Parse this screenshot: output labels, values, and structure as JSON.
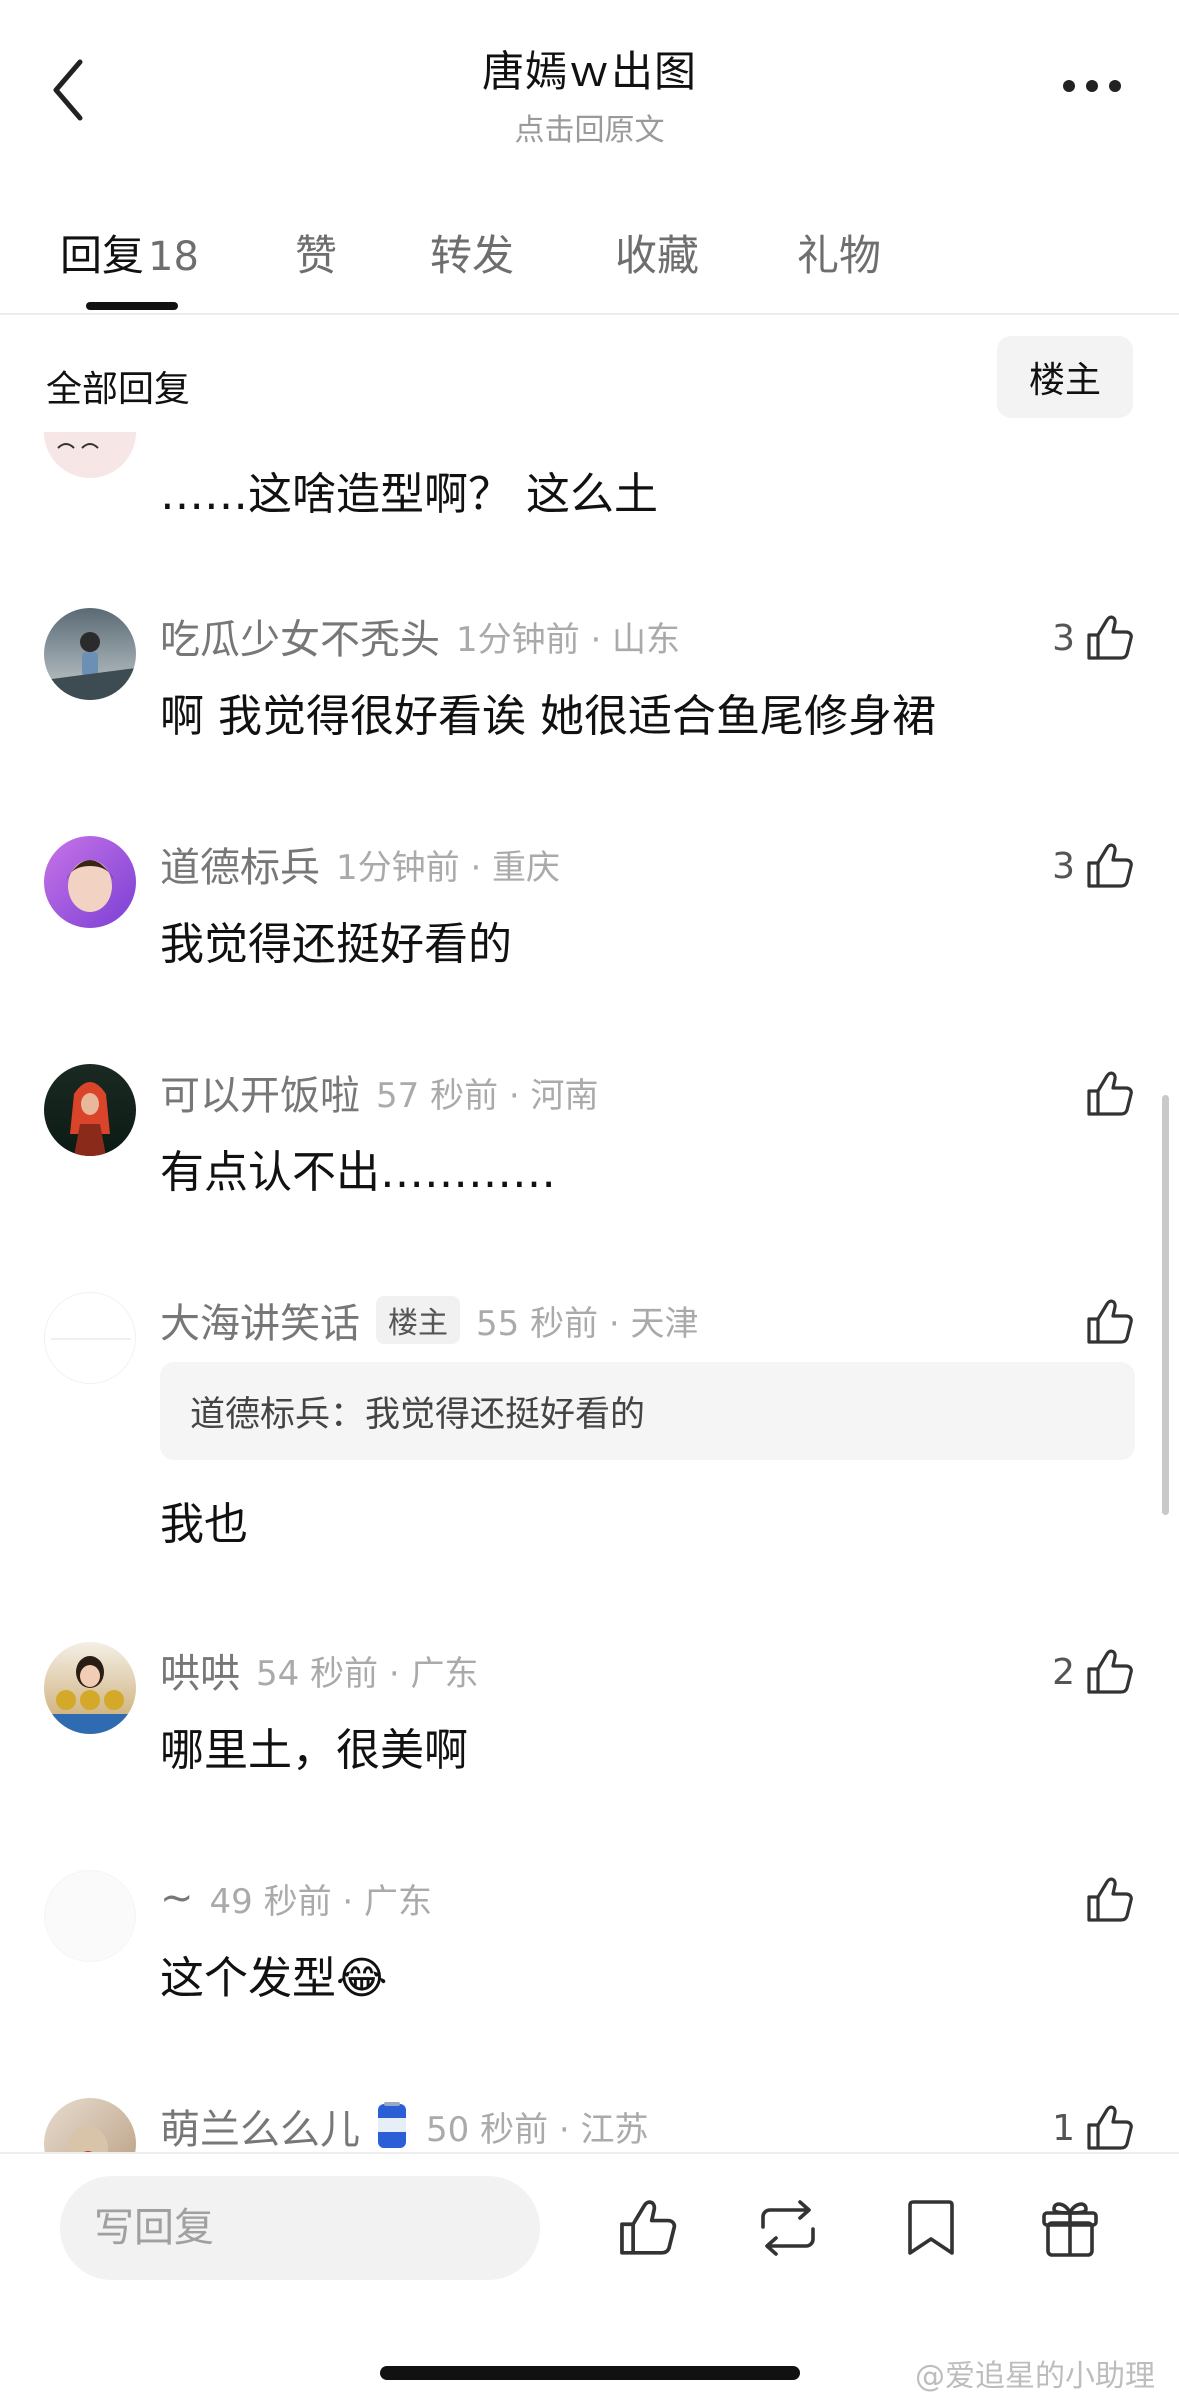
{
  "header": {
    "title": "唐嫣ｗ出图",
    "subtitle": "点击回原文"
  },
  "tabs": [
    {
      "label": "回复",
      "count": "18"
    },
    {
      "label": "赞"
    },
    {
      "label": "转发"
    },
    {
      "label": "收藏"
    },
    {
      "label": "礼物"
    }
  ],
  "filter": {
    "label": "全部回复",
    "owner_button": "楼主"
  },
  "comments": [
    {
      "username": "",
      "time": "",
      "text": "……这啥造型啊？ 这么土",
      "likes": ""
    },
    {
      "username": "吃瓜少女不秃头",
      "time": "1分钟前 · 山东",
      "text": "啊 我觉得很好看诶 她很适合鱼尾修身裙",
      "likes": "3"
    },
    {
      "username": "道德标兵",
      "time": "1分钟前 · 重庆",
      "text": "我觉得还挺好看的",
      "likes": "3"
    },
    {
      "username": "可以开饭啦",
      "time": "57 秒前 · 河南",
      "text": "有点认不出…………",
      "likes": ""
    },
    {
      "username": "大海讲笑话",
      "badge": "楼主",
      "time": "55 秒前 · 天津",
      "quote": "道德标兵：我觉得还挺好看的",
      "text": "我也",
      "likes": ""
    },
    {
      "username": "哄哄",
      "time": "54 秒前 · 广东",
      "text": "哪里土，很美啊",
      "likes": "2"
    },
    {
      "username": "~",
      "time": "49 秒前 · 广东",
      "text": "这个发型😂",
      "likes": ""
    },
    {
      "username": "萌兰么么儿",
      "time": "50 秒前 · 江苏",
      "text": "",
      "likes": "1"
    }
  ],
  "bottom_bar": {
    "reply_placeholder": "写回复",
    "icons": [
      "like-icon",
      "repost-icon",
      "bookmark-icon",
      "gift-icon"
    ]
  },
  "watermark": "@爱追星的小助理"
}
